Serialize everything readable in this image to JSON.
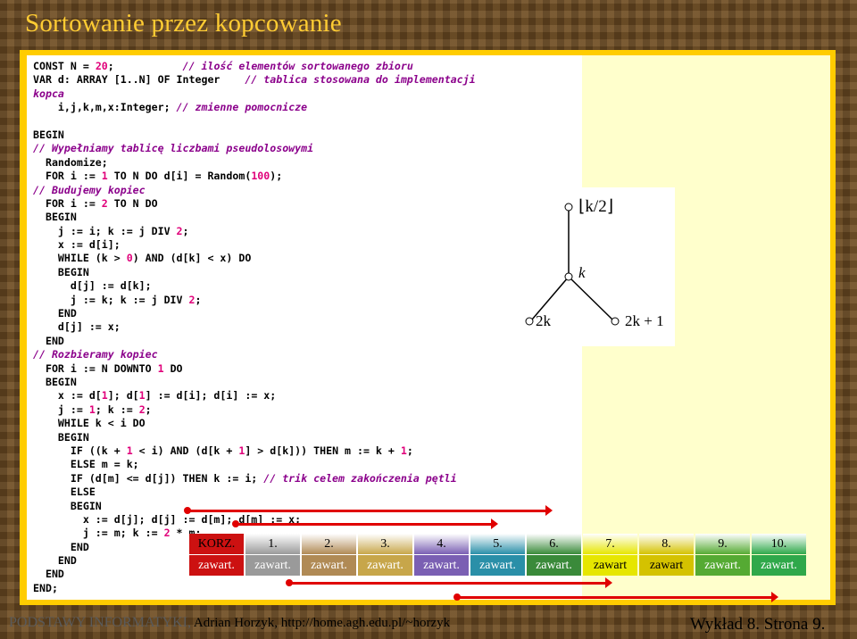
{
  "header": {
    "title": "Sortowanie przez kopcowanie"
  },
  "code_lines": [
    [
      {
        "t": "CONST N = ",
        "c": "kw"
      },
      {
        "t": "20",
        "c": "num"
      },
      {
        "t": ";           ",
        "c": "kw"
      },
      {
        "t": "// ilość elementów sortowanego zbioru",
        "c": "cm"
      }
    ],
    [
      {
        "t": "VAR d: ARRAY [1..N] OF Integer    ",
        "c": "kw"
      },
      {
        "t": "// tablica stosowana do implementacji",
        "c": "cm"
      }
    ],
    [
      {
        "t": "kopca",
        "c": "cm"
      }
    ],
    [
      {
        "t": "    i,j,k,m,x:Integer; ",
        "c": "kw"
      },
      {
        "t": "// zmienne pomocnicze",
        "c": "cm"
      }
    ],
    [
      {
        "t": "",
        "c": "kw"
      }
    ],
    [
      {
        "t": "BEGIN",
        "c": "kw"
      }
    ],
    [
      {
        "t": "// Wypełniamy tablicę liczbami pseudolosowymi",
        "c": "cm"
      }
    ],
    [
      {
        "t": "  Randomize;",
        "c": "kw"
      }
    ],
    [
      {
        "t": "  FOR i := ",
        "c": "kw"
      },
      {
        "t": "1",
        "c": "num"
      },
      {
        "t": " TO N DO d[i] = Random(",
        "c": "kw"
      },
      {
        "t": "100",
        "c": "num"
      },
      {
        "t": ");",
        "c": "kw"
      }
    ],
    [
      {
        "t": "// Budujemy kopiec",
        "c": "cm"
      }
    ],
    [
      {
        "t": "  FOR i := ",
        "c": "kw"
      },
      {
        "t": "2",
        "c": "num"
      },
      {
        "t": " TO N DO",
        "c": "kw"
      }
    ],
    [
      {
        "t": "  BEGIN",
        "c": "kw"
      }
    ],
    [
      {
        "t": "    j := i; k := j DIV ",
        "c": "kw"
      },
      {
        "t": "2",
        "c": "num"
      },
      {
        "t": ";",
        "c": "kw"
      }
    ],
    [
      {
        "t": "    x := d[i];",
        "c": "kw"
      }
    ],
    [
      {
        "t": "    WHILE (k > ",
        "c": "kw"
      },
      {
        "t": "0",
        "c": "num"
      },
      {
        "t": ") AND (d[k] < x) DO",
        "c": "kw"
      }
    ],
    [
      {
        "t": "    BEGIN",
        "c": "kw"
      }
    ],
    [
      {
        "t": "      d[j] := d[k];",
        "c": "kw"
      }
    ],
    [
      {
        "t": "      j := k; k := j DIV ",
        "c": "kw"
      },
      {
        "t": "2",
        "c": "num"
      },
      {
        "t": ";",
        "c": "kw"
      }
    ],
    [
      {
        "t": "    END",
        "c": "kw"
      }
    ],
    [
      {
        "t": "    d[j] := x;",
        "c": "kw"
      }
    ],
    [
      {
        "t": "  END",
        "c": "kw"
      }
    ],
    [
      {
        "t": "// Rozbieramy kopiec",
        "c": "cm"
      }
    ],
    [
      {
        "t": "  FOR i := N DOWNTO ",
        "c": "kw"
      },
      {
        "t": "1",
        "c": "num"
      },
      {
        "t": " DO",
        "c": "kw"
      }
    ],
    [
      {
        "t": "  BEGIN",
        "c": "kw"
      }
    ],
    [
      {
        "t": "    x := d[",
        "c": "kw"
      },
      {
        "t": "1",
        "c": "num"
      },
      {
        "t": "]; d[",
        "c": "kw"
      },
      {
        "t": "1",
        "c": "num"
      },
      {
        "t": "] := d[i]; d[i] := x;",
        "c": "kw"
      }
    ],
    [
      {
        "t": "    j := ",
        "c": "kw"
      },
      {
        "t": "1",
        "c": "num"
      },
      {
        "t": "; k := ",
        "c": "kw"
      },
      {
        "t": "2",
        "c": "num"
      },
      {
        "t": ";",
        "c": "kw"
      }
    ],
    [
      {
        "t": "    WHILE k < i DO",
        "c": "kw"
      }
    ],
    [
      {
        "t": "    BEGIN",
        "c": "kw"
      }
    ],
    [
      {
        "t": "      IF ((k + ",
        "c": "kw"
      },
      {
        "t": "1",
        "c": "num"
      },
      {
        "t": " < i) AND (d[k + ",
        "c": "kw"
      },
      {
        "t": "1",
        "c": "num"
      },
      {
        "t": "] > d[k])) THEN m := k + ",
        "c": "kw"
      },
      {
        "t": "1",
        "c": "num"
      },
      {
        "t": ";",
        "c": "kw"
      }
    ],
    [
      {
        "t": "      ELSE m = k;",
        "c": "kw"
      }
    ],
    [
      {
        "t": "      IF (d[m] <= d[j]) THEN k := i; ",
        "c": "kw"
      },
      {
        "t": "// trik celem zakończenia pętli",
        "c": "cm"
      }
    ],
    [
      {
        "t": "      ELSE",
        "c": "kw"
      }
    ],
    [
      {
        "t": "      BEGIN",
        "c": "kw"
      }
    ],
    [
      {
        "t": "        x := d[j]; d[j] := d[m]; d[m] := x;",
        "c": "kw"
      }
    ],
    [
      {
        "t": "        j := m; k := ",
        "c": "kw"
      },
      {
        "t": "2",
        "c": "num"
      },
      {
        "t": " * m;",
        "c": "kw"
      }
    ],
    [
      {
        "t": "      END",
        "c": "kw"
      }
    ],
    [
      {
        "t": "    END",
        "c": "kw"
      }
    ],
    [
      {
        "t": "  END",
        "c": "kw"
      }
    ],
    [
      {
        "t": "END;",
        "c": "kw"
      }
    ]
  ],
  "diagram": {
    "top_label": "⌊k/2⌋",
    "mid_label": "k",
    "left_label": "2k",
    "right_label": "2k + 1"
  },
  "table": {
    "headers": [
      "KORZ.",
      "1.",
      "2.",
      "3.",
      "4.",
      "5.",
      "6.",
      "7.",
      "8.",
      "9.",
      "10."
    ],
    "values": [
      "zawart.",
      "zawart.",
      "zawart.",
      "zawart.",
      "zawart.",
      "zawart.",
      "zawart.",
      "zawart",
      "zawart",
      "zawart.",
      "zawart."
    ],
    "colors": [
      "#cc1111",
      "#9a9a9a",
      "#b08a55",
      "#c7a64a",
      "#7a5fb3",
      "#2a8fa8",
      "#3a8a3a",
      "#e6e600",
      "#d4c200",
      "#55aa33",
      "#2fa84a"
    ]
  },
  "footer": {
    "left": "PODSTAWY INFORMATYKI,",
    "left_sub": " Adrian Horzyk, http://home.agh.edu.pl/~horzyk",
    "right": "Wykład 8.  Strona 9."
  }
}
